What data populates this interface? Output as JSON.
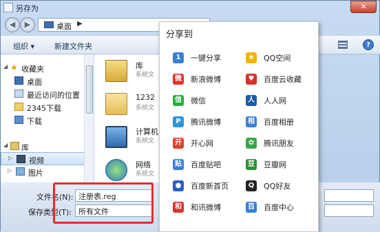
{
  "window": {
    "title": "另存为",
    "close_label": "✕"
  },
  "nav": {
    "back_label": "◀",
    "forward_label": "▶",
    "address": "桌面",
    "address_sep": "▶"
  },
  "toolbar": {
    "organize": "组织 ▾",
    "new_folder": "新建文件夹",
    "help": "?"
  },
  "sidebar": {
    "items": [
      {
        "label": "收藏夹",
        "tri": "◢",
        "icon": "star-icon"
      },
      {
        "label": "桌面",
        "icon": "desktop-icon"
      },
      {
        "label": "最近访问的位置",
        "icon": "recent-icon"
      },
      {
        "label": "2345下载",
        "icon": "folder-icon"
      },
      {
        "label": "下载",
        "icon": "download-icon"
      },
      {
        "label": "库",
        "tri": "◢",
        "icon": "library-icon"
      },
      {
        "label": "视频",
        "tri": "▷",
        "icon": "video-icon"
      },
      {
        "label": "图片",
        "tri": "▷",
        "icon": "picture-icon"
      }
    ]
  },
  "files": [
    {
      "name": "库",
      "desc": "系统文",
      "icon": "library-icon"
    },
    {
      "name": "1232",
      "desc": "系统文",
      "icon": "user-icon"
    },
    {
      "name": "计算机",
      "desc": "系统文",
      "icon": "computer-icon"
    },
    {
      "name": "网络",
      "desc": "系统文",
      "icon": "network-icon"
    }
  ],
  "bottom": {
    "filename_label": "文件名(N):",
    "filename_value": "注册表.reg",
    "type_label": "保存类型(T):",
    "type_value": "所有文件"
  },
  "share": {
    "title": "分享到",
    "items": [
      {
        "label": "一键分享",
        "icon": "one-click-share-icon",
        "glyph": "1",
        "color": "#3a7fd5"
      },
      {
        "label": "QQ空间",
        "icon": "qzone-icon",
        "glyph": "★",
        "color": "#f2b300"
      },
      {
        "label": "新浪微博",
        "icon": "sina-weibo-icon",
        "glyph": "微",
        "color": "#e2342c"
      },
      {
        "label": "百度云收藏",
        "icon": "heart-icon",
        "glyph": "♥",
        "color": "#d9322d"
      },
      {
        "label": "微信",
        "icon": "wechat-icon",
        "glyph": "信",
        "color": "#2bad3c"
      },
      {
        "label": "人人网",
        "icon": "renren-icon",
        "glyph": "人",
        "color": "#1d5aa8"
      },
      {
        "label": "腾讯微博",
        "icon": "tencent-weibo-icon",
        "glyph": "P",
        "color": "#2c96d7"
      },
      {
        "label": "百度相册",
        "icon": "baidu-album-icon",
        "glyph": "相",
        "color": "#3a7fd5"
      },
      {
        "label": "开心网",
        "icon": "kaixin-icon",
        "glyph": "开",
        "color": "#d9452d"
      },
      {
        "label": "腾讯朋友",
        "icon": "tencent-friend-icon",
        "glyph": "✿",
        "color": "#3aa54a"
      },
      {
        "label": "百度贴吧",
        "icon": "tieba-icon",
        "glyph": "贴",
        "color": "#3a7fd5"
      },
      {
        "label": "豆瓣网",
        "icon": "douban-icon",
        "glyph": "豆",
        "color": "#2f8e37"
      },
      {
        "label": "百度新首页",
        "icon": "paw-icon",
        "glyph": "●",
        "color": "#2c5fc5"
      },
      {
        "label": "QQ好友",
        "icon": "qq-friend-icon",
        "glyph": "Q",
        "color": "#222"
      },
      {
        "label": "和讯微博",
        "icon": "hexun-icon",
        "glyph": "和",
        "color": "#d9322d"
      },
      {
        "label": "百度中心",
        "icon": "baidu-center-icon",
        "glyph": "百",
        "color": "#3a7fd5"
      }
    ]
  }
}
